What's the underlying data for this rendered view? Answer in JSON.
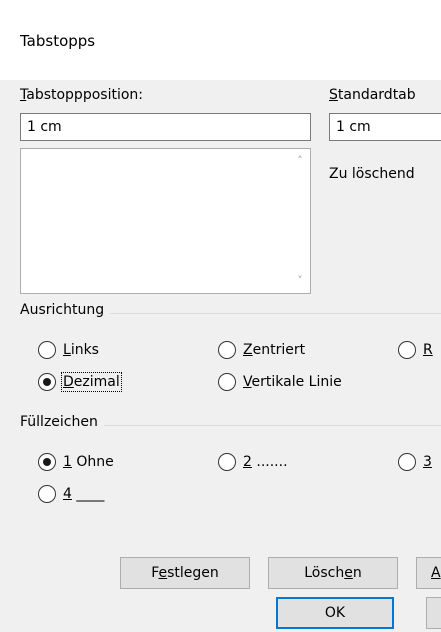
{
  "dialog": {
    "title": "Tabstopps"
  },
  "tab_position": {
    "label_accel": "T",
    "label_rest": "abstoppposition:",
    "value": "1 cm",
    "list_items": []
  },
  "standard_tab": {
    "label_accel": "S",
    "label_rest": "tandardtab",
    "value": "1 cm"
  },
  "to_delete_label": "Zu löschend",
  "alignment": {
    "label": "Ausrichtung",
    "options": [
      {
        "accel": "L",
        "rest": "inks",
        "selected": false
      },
      {
        "accel": "Z",
        "rest": "entriert",
        "selected": false
      },
      {
        "accel": "R",
        "rest": "",
        "selected": false
      },
      {
        "accel": "D",
        "rest": "ezimal",
        "selected": true
      },
      {
        "accel": "V",
        "rest": "ertikale Linie",
        "selected": false
      }
    ]
  },
  "leader": {
    "label": "Füllzeichen",
    "options": [
      {
        "accel": "1",
        "rest": " Ohne",
        "selected": true
      },
      {
        "accel": "2",
        "rest": " .......",
        "selected": false
      },
      {
        "accel": "3",
        "rest": "",
        "selected": false
      },
      {
        "accel": "4",
        "rest": " ____",
        "selected": false
      }
    ]
  },
  "buttons": {
    "set_pre": "F",
    "set_accel": "e",
    "set_post": "stlegen",
    "delete_pre": "Lösch",
    "delete_accel": "e",
    "delete_post": "n",
    "delete_all_accel": "A",
    "ok": "OK"
  }
}
